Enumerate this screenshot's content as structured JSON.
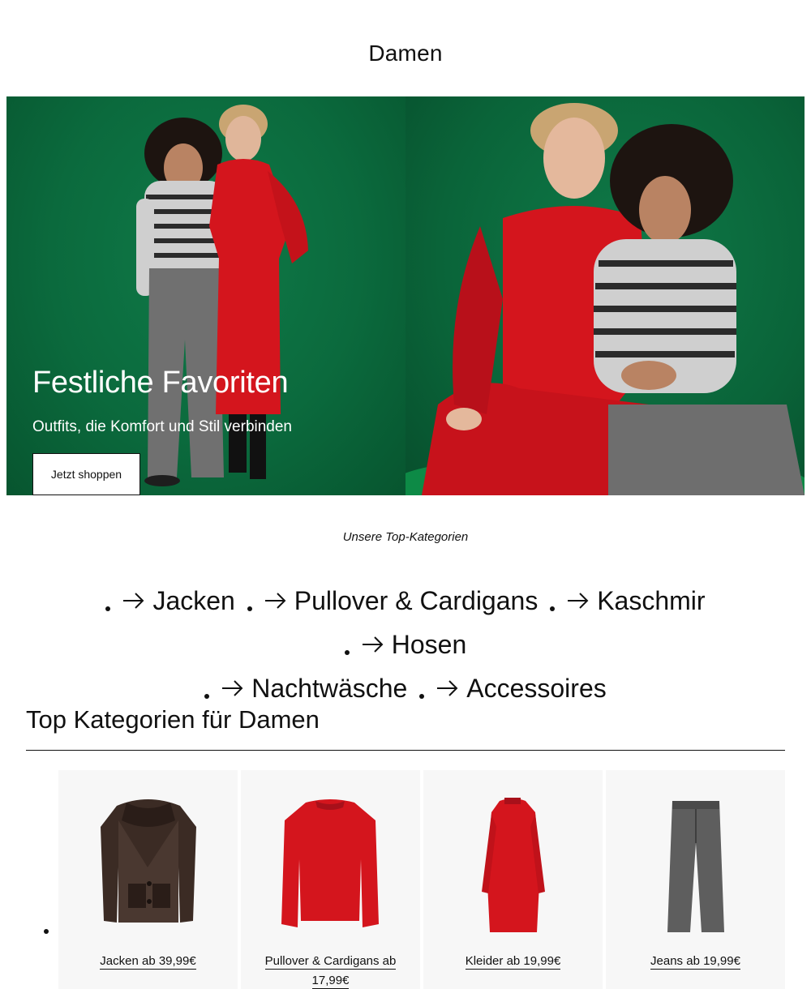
{
  "page": {
    "title": "Damen"
  },
  "hero": {
    "heading": "Festliche Favoriten",
    "subheading": "Outfits, die Komfort und Stil verbinden",
    "cta_label": "Jetzt shoppen",
    "background_color": "#0b6a3d"
  },
  "top_categories": {
    "label": "Unsere Top-Kategorien",
    "links": [
      {
        "label": "Jacken"
      },
      {
        "label": "Pullover & Cardigans"
      },
      {
        "label": "Kaschmir"
      },
      {
        "label": "Hosen"
      },
      {
        "label": "Nachtwäsche"
      },
      {
        "label": "Accessoires"
      }
    ]
  },
  "section": {
    "title": "Top Kategorien für Damen",
    "cards": [
      {
        "label": "Jacken ab 39,99€",
        "image": "brown-shearling-jacket"
      },
      {
        "label": "Pullover & Cardigans ab 17,99€",
        "image": "red-knit-sweater"
      },
      {
        "label": "Kleider ab 19,99€",
        "image": "red-knit-dress"
      },
      {
        "label": "Jeans ab 19,99€",
        "image": "grey-wide-leg-jeans"
      }
    ]
  },
  "colors": {
    "green": "#0b6a3d",
    "red": "#d4151d",
    "grey": "#6b6b6b",
    "text": "#111111"
  }
}
